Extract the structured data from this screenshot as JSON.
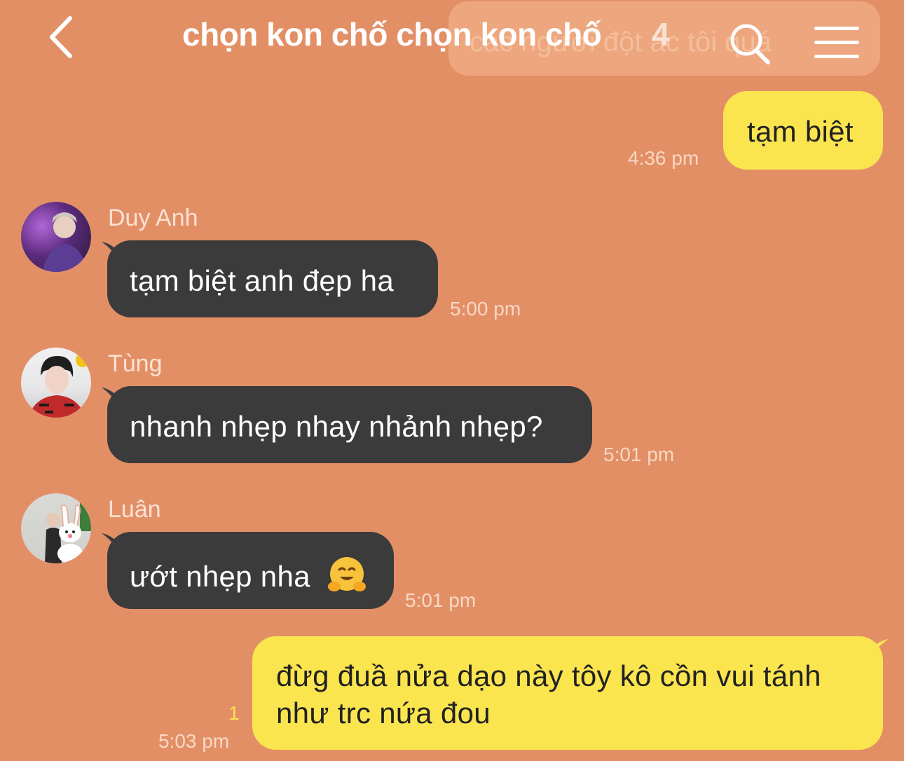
{
  "header": {
    "title": "chọn kon chố chọn kon chố",
    "member_count": "4",
    "ghost_text": "các người đột ác tôi quá"
  },
  "messages": [
    {
      "side": "mine",
      "text": "tạm biệt",
      "time": "4:36 pm"
    },
    {
      "side": "theirs",
      "sender": "Duy Anh",
      "text": "tạm biệt anh đẹp ha",
      "time": "5:00 pm"
    },
    {
      "side": "theirs",
      "sender": "Tùng",
      "text": "nhanh nhẹp nhay nhảnh nhẹp?",
      "time": "5:01 pm"
    },
    {
      "side": "theirs",
      "sender": "Luân",
      "text": "ướt nhẹp nha",
      "emoji": "🤗",
      "time": "5:01 pm"
    },
    {
      "side": "mine",
      "text": "đừg đuầ nửa dạo này tôy kô cồn vui tánh như trc nứa đou",
      "time": "5:03 pm",
      "unread": "1"
    }
  ],
  "colors": {
    "background": "#E38F66",
    "mine_bubble": "#FBE54F",
    "theirs_bubble": "#3B3B3C"
  },
  "icons": {
    "back": "chevron-left-icon",
    "search": "search-icon",
    "menu": "hamburger-menu-icon"
  }
}
